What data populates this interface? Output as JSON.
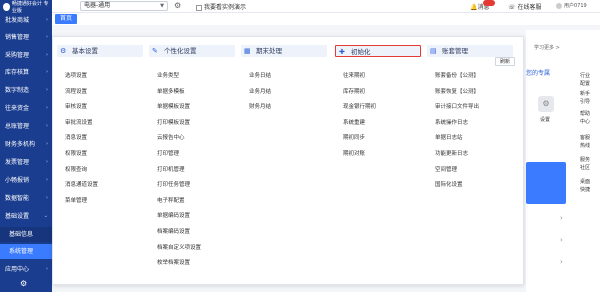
{
  "app": {
    "logo_text": "畅捷通好会计 专业版"
  },
  "header": {
    "account_select": "电器-通用",
    "demo_label": "我要看实例演示",
    "messages_label": "消息",
    "messages_badge": "",
    "service_label": "在线客服",
    "user_label": "用户0719"
  },
  "sidebar": {
    "items": [
      {
        "label": "批发商城"
      },
      {
        "label": "销售管理"
      },
      {
        "label": "采购管理"
      },
      {
        "label": "库存核算"
      },
      {
        "label": "数字制造"
      },
      {
        "label": "往来资金"
      },
      {
        "label": "总账管理"
      },
      {
        "label": "财务多机构"
      },
      {
        "label": "发票管理"
      },
      {
        "label": "小畅报销"
      },
      {
        "label": "数据智能"
      },
      {
        "label": "基础设置"
      },
      {
        "label": "基础信息"
      },
      {
        "label": "系统管理"
      },
      {
        "label": "应用中心"
      }
    ]
  },
  "tabs": {
    "home": "首页"
  },
  "menu": {
    "refresh_label": "刷新",
    "columns": [
      {
        "title": "基本设置",
        "icon": "settings-icon",
        "items": [
          "选项设置",
          "流程设置",
          "审核设置",
          "审批流设置",
          "消息设置",
          "权限设置",
          "权限查询",
          "消息通道设置",
          "菜单管理"
        ]
      },
      {
        "title": "个性化设置",
        "icon": "customize-icon",
        "items": [
          "业务类型",
          "单据多模板",
          "单据模板设置",
          "打印模板设置",
          "云报告中心",
          "打印管理",
          "打印机管理",
          "打印任务管理",
          "电子秤配置",
          "单据编码设置",
          "档案编码设置",
          "档案自定义项设置",
          "枚举档案设置"
        ]
      },
      {
        "title": "期末处理",
        "icon": "period-end-icon",
        "items": [
          "业务日结",
          "业务月结",
          "财务月结"
        ]
      },
      {
        "title": "初始化",
        "icon": "initialize-icon",
        "items": [
          "往来期初",
          "库存期初",
          "现金银行期初",
          "系统重建",
          "期初同步",
          "期初对账"
        ]
      },
      {
        "title": "账套管理",
        "icon": "ledger-icon",
        "items": [
          "账套备份【公测】",
          "账套恢复【公测】",
          "审计接口文件导出",
          "系统操作日志",
          "单据日志站",
          "功能更新日志",
          "空间管理",
          "国际化设置"
        ]
      }
    ]
  },
  "right_panel": {
    "learn_more": "学习更多 >",
    "exclusive": "您的专属",
    "industry": "行业",
    "industry2": "配置",
    "setup_label": "设置",
    "newbie": "新手",
    "newbie2": "引导",
    "help": "帮助",
    "help2": "中心",
    "service_hotline": "客服",
    "service_hotline2": "热线",
    "service_community": "服务",
    "service_community2": "社区",
    "desktop": "桌面",
    "desktop2": "快捷"
  }
}
